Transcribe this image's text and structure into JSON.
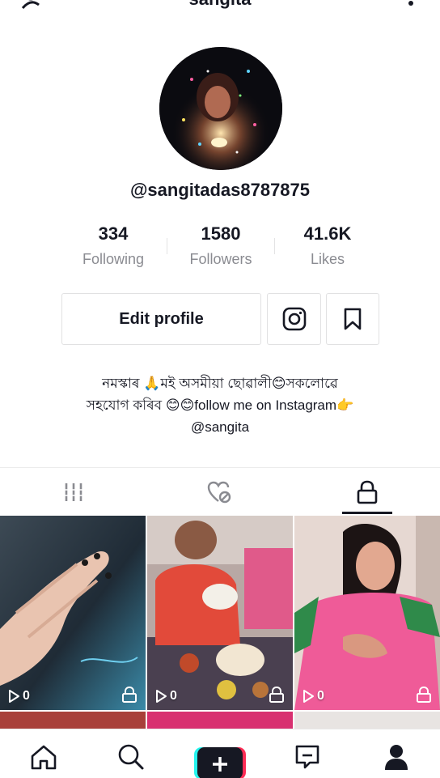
{
  "header": {
    "title": "sangita",
    "add_friend_icon": "add-user-icon",
    "more_icon": "more-icon"
  },
  "profile": {
    "handle": "@sangitadas8787875",
    "stats": [
      {
        "value": "334",
        "label": "Following"
      },
      {
        "value": "1580",
        "label": "Followers"
      },
      {
        "value": "41.6K",
        "label": "Likes"
      }
    ],
    "edit_profile_label": "Edit profile",
    "bio_line1": "নমস্কাৰ 🙏মই অসমীয়া ছোৱালী😊সকলোৱে",
    "bio_line2": "সহযোগ কৰিব 😊😊follow me on Instagram👉",
    "bio_line3": "@sangita"
  },
  "tabs": [
    {
      "name": "videos-tab",
      "icon": "grid-icon"
    },
    {
      "name": "liked-tab",
      "icon": "hidden-heart-icon"
    },
    {
      "name": "private-tab",
      "icon": "lock-icon",
      "selected": true
    }
  ],
  "videos": [
    {
      "views": "0"
    },
    {
      "views": "0"
    },
    {
      "views": "0"
    }
  ],
  "bottom_nav": [
    {
      "name": "home",
      "icon": "home-icon"
    },
    {
      "name": "discover",
      "icon": "search-icon"
    },
    {
      "name": "create",
      "icon": "plus-icon"
    },
    {
      "name": "inbox",
      "icon": "inbox-icon"
    },
    {
      "name": "me",
      "icon": "profile-icon",
      "selected": true
    }
  ],
  "colors": {
    "accent_pink": "#fe2c55",
    "accent_cyan": "#25f4ee",
    "text_primary": "#161823",
    "text_secondary": "#8a8b91"
  }
}
